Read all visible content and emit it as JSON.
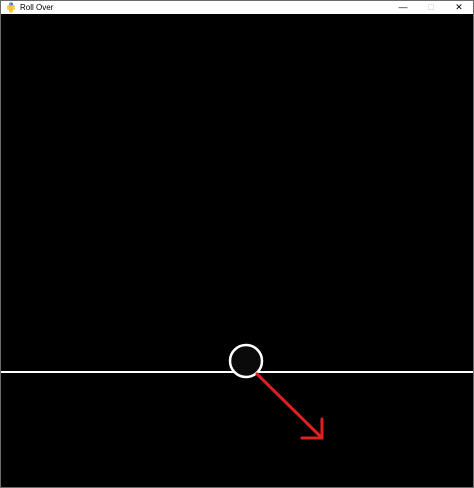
{
  "window": {
    "title": "Roll Over",
    "app_icon": "pygame-snake-icon",
    "controls": {
      "minimize": "—",
      "maximize": "□",
      "close": "✕"
    }
  },
  "scene": {
    "background_color": "#000000",
    "ground_color": "#ffffff",
    "ball_outline_color": "#ffffff",
    "ball_fill_color": "#0a0a0a",
    "arrow_color": "#e02020",
    "arrow_direction": "down-right"
  }
}
